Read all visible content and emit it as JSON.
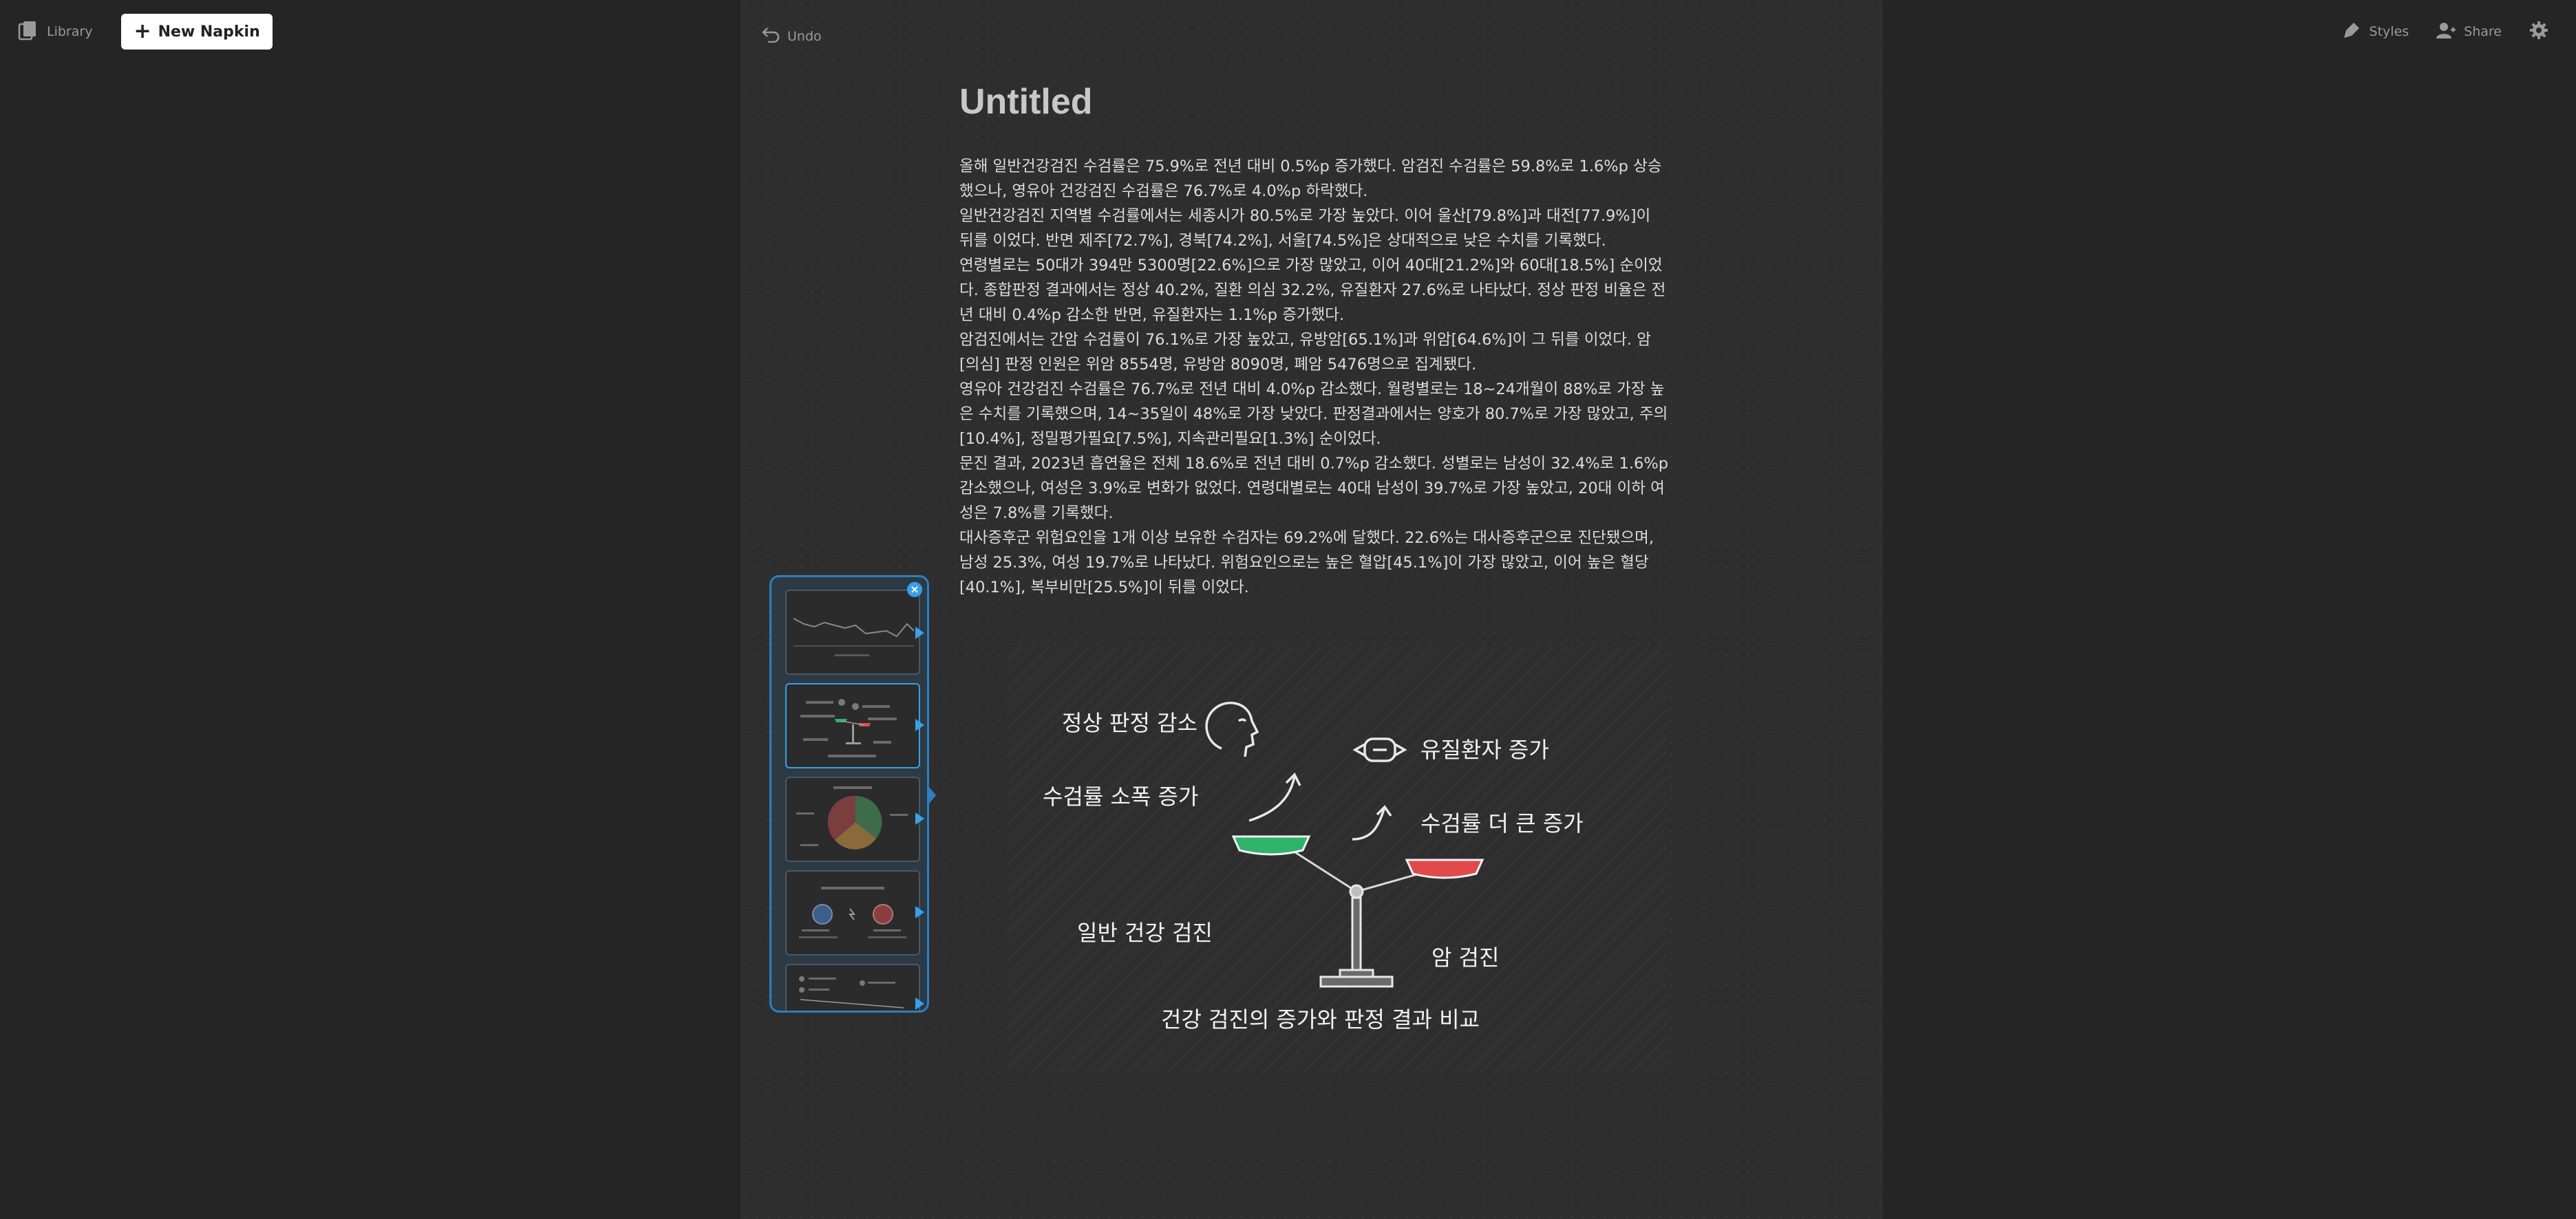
{
  "topbar": {
    "library_label": "Library",
    "new_napkin_label": "New Napkin",
    "styles_label": "Styles",
    "share_label": "Share"
  },
  "doc": {
    "undo_label": "Undo",
    "title": "Untitled",
    "paragraphs": [
      "올해 일반건강검진 수검률은 75.9%로 전년 대비 0.5%p 증가했다. 암검진 수검률은 59.8%로 1.6%p 상승했으나, 영유아 건강검진 수검률은 76.7%로 4.0%p 하락했다.",
      "일반건강검진 지역별 수검률에서는 세종시가 80.5%로 가장 높았다. 이어 울산[79.8%]과 대전[77.9%]이 뒤를 이었다. 반면 제주[72.7%], 경북[74.2%], 서울[74.5%]은 상대적으로 낮은 수치를 기록했다.",
      "연령별로는 50대가 394만 5300명[22.6%]으로 가장 많았고, 이어 40대[21.2%]와 60대[18.5%] 순이었다. 종합판정 결과에서는 정상 40.2%, 질환 의심 32.2%, 유질환자 27.6%로 나타났다. 정상 판정 비율은 전년 대비 0.4%p 감소한 반면, 유질환자는 1.1%p 증가했다.",
      "암검진에서는 간암 수검률이 76.1%로 가장 높았고, 유방암[65.1%]과 위암[64.6%]이 그 뒤를 이었다. 암[의심] 판정 인원은 위암 8554명, 유방암 8090명, 폐암 5476명으로 집계됐다.",
      "영유아 건강검진 수검률은 76.7%로 전년 대비 4.0%p 감소했다. 월령별로는 18~24개월이 88%로 가장 높은 수치를 기록했으며, 14~35일이 48%로 가장 낮았다. 판정결과에서는 양호가 80.7%로 가장 많았고, 주의[10.4%], 정밀평가필요[7.5%], 지속관리필요[1.3%] 순이었다.",
      "문진 결과, 2023년 흡연율은 전체 18.6%로 전년 대비 0.7%p 감소했다. 성별로는 남성이 32.4%로 1.6%p 감소했으나, 여성은 3.9%로 변화가 없었다. 연령대별로는 40대 남성이 39.7%로 가장 높았고, 20대 이하 여성은 7.8%를 기록했다.",
      "대사증후군 위험요인을 1개 이상 보유한 수검자는 69.2%에 달했다. 22.6%는 대사증후군으로 진단됐으며, 남성 25.3%, 여성 19.7%로 나타났다. 위험요인으로는 높은 혈압[45.1%]이 가장 많았고, 이어 높은 혈당[40.1%], 복부비만[25.5%]이 뒤를 이었다."
    ]
  },
  "visual": {
    "label_normal_decrease": "정상 판정 감소",
    "label_rate_small_increase": "수검률 소폭 증가",
    "label_general_checkup": "일반 건강 검진",
    "label_disease_increase": "유질환자 증가",
    "label_rate_big_increase": "수검률 더 큰 증가",
    "label_cancer_checkup": "암 검진",
    "caption": "건강 검진의 증가와 판정 결과 비교",
    "colors": {
      "green": "#2fb36b",
      "red": "#e04a4a",
      "line": "#d8d8d8"
    }
  },
  "thumbnails": {
    "count": 5,
    "selected_index": 1,
    "types": [
      "line-chart",
      "scale-comparison",
      "pie-chart",
      "two-circle-compare",
      "list-layout"
    ]
  }
}
